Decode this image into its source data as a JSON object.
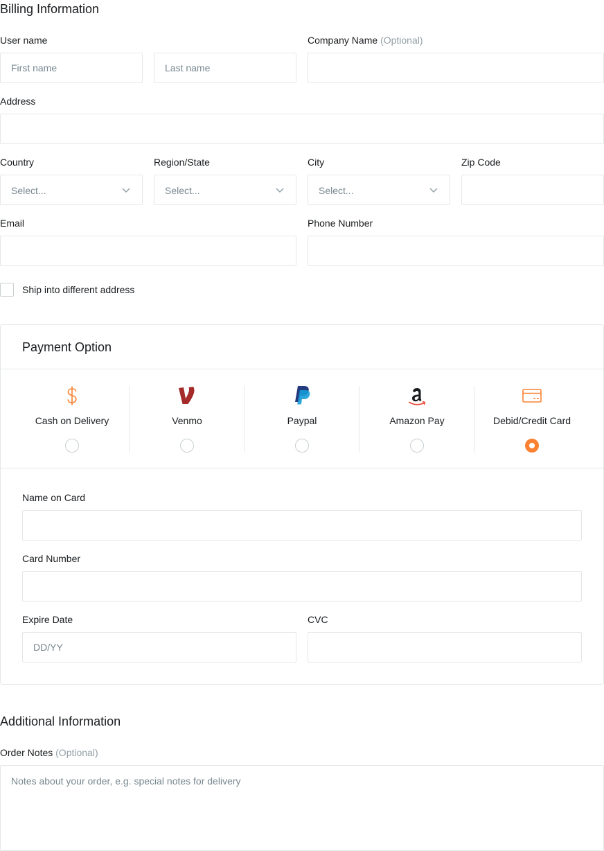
{
  "billing": {
    "title": "Billing Information",
    "user_name_label": "User name",
    "first_name_placeholder": "First name",
    "last_name_placeholder": "Last name",
    "company_label": "Company Name",
    "company_optional": "(Optional)",
    "address_label": "Address",
    "country_label": "Country",
    "country_value": "Select...",
    "region_label": "Region/State",
    "region_value": "Select...",
    "city_label": "City",
    "city_value": "Select...",
    "zip_label": "Zip Code",
    "email_label": "Email",
    "phone_label": "Phone Number",
    "ship_label": "Ship into different address"
  },
  "payment": {
    "title": "Payment Option",
    "options": [
      {
        "label": "Cash on Delivery",
        "icon": "dollar-icon",
        "selected": false
      },
      {
        "label": "Venmo",
        "icon": "venmo-icon",
        "selected": false
      },
      {
        "label": "Paypal",
        "icon": "paypal-icon",
        "selected": false
      },
      {
        "label": "Amazon Pay",
        "icon": "amazon-icon",
        "selected": false
      },
      {
        "label": "Debid/Credit Card",
        "icon": "credit-card-icon",
        "selected": true
      }
    ],
    "name_on_card_label": "Name on Card",
    "card_number_label": "Card Number",
    "expire_label": "Expire Date",
    "expire_placeholder": "DD/YY",
    "cvc_label": "CVC"
  },
  "additional": {
    "title": "Additional Information",
    "notes_label": "Order Notes",
    "notes_optional": "(Optional)",
    "notes_placeholder": "Notes about your order, e.g. special notes for delivery"
  },
  "colors": {
    "accent": "#fa8232",
    "border": "#e4e7e9",
    "text": "#191c1f",
    "muted": "#77878f",
    "venmo": "#a52a2a",
    "paypal_dark": "#253b80",
    "paypal_light": "#179bd7"
  }
}
